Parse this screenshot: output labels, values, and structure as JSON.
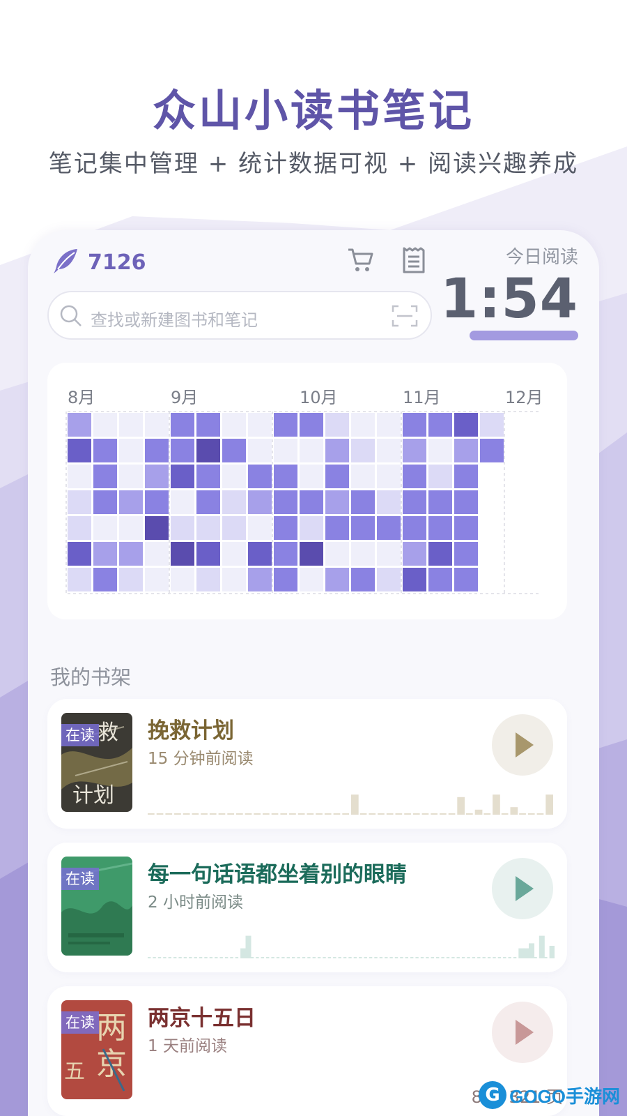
{
  "promo": {
    "title": "众山小读书笔记",
    "subtitle": "笔记集中管理 + 统计数据可视 + 阅读兴趣养成"
  },
  "header": {
    "coins": "7126",
    "icons": [
      "feather-icon",
      "cart-icon",
      "receipt-icon"
    ],
    "today_label": "今日阅读",
    "today_time": "1:54"
  },
  "search": {
    "placeholder": "查找或新建图书和笔记",
    "icons": [
      "search-icon",
      "scan-icon"
    ]
  },
  "heatmap": {
    "months": [
      "8月",
      "9月",
      "10月",
      "11月",
      "12月"
    ],
    "palette": [
      "#efeffa",
      "#dcdaf6",
      "#a7a0ea",
      "#8a82e2",
      "#6a5fc8",
      "#5a4cae"
    ],
    "columns": [
      [
        2,
        4,
        0,
        1,
        1,
        4,
        1
      ],
      [
        0,
        3,
        3,
        3,
        0,
        2,
        3
      ],
      [
        0,
        0,
        0,
        2,
        0,
        2,
        1
      ],
      [
        0,
        3,
        2,
        3,
        5,
        0,
        0
      ],
      [
        3,
        3,
        4,
        0,
        1,
        5,
        0
      ],
      [
        3,
        5,
        3,
        3,
        1,
        4,
        1
      ],
      [
        0,
        3,
        0,
        1,
        1,
        0,
        0
      ],
      [
        0,
        0,
        3,
        2,
        0,
        4,
        2
      ],
      [
        3,
        0,
        3,
        3,
        3,
        3,
        3
      ],
      [
        3,
        0,
        0,
        3,
        1,
        5,
        0
      ],
      [
        1,
        2,
        3,
        2,
        3,
        0,
        2
      ],
      [
        0,
        1,
        0,
        3,
        3,
        0,
        3
      ],
      [
        0,
        0,
        0,
        1,
        3,
        0,
        1
      ],
      [
        3,
        2,
        3,
        3,
        3,
        2,
        4
      ],
      [
        3,
        0,
        1,
        3,
        3,
        4,
        3
      ],
      [
        4,
        2,
        3,
        3,
        3,
        3,
        3
      ],
      [
        1,
        3
      ]
    ]
  },
  "shelf": {
    "title": "我的书架",
    "books": [
      {
        "title": "挽救计划",
        "time": "15 分钟前阅读",
        "status": "在读",
        "title_color": "#7a6533",
        "time_color": "#9a8a70",
        "button_bg": "#f1eee8",
        "accent": "#a8976c",
        "bar_color": "#e4dece",
        "bars": [
          0,
          0,
          0,
          0,
          0,
          0,
          0,
          0,
          0,
          0,
          0,
          0,
          0,
          0,
          0,
          0,
          0,
          0,
          0,
          0,
          0,
          0,
          0,
          8,
          0,
          0,
          0,
          0,
          0,
          0,
          0,
          0,
          0,
          0,
          0,
          7,
          0,
          2,
          0,
          8,
          0,
          3,
          0,
          0,
          0,
          8
        ]
      },
      {
        "title": "每一句话语都坐着别的眼睛",
        "time": "2 小时前阅读",
        "status": "在读",
        "title_color": "#1b6b5a",
        "time_color": "#7a8a86",
        "button_bg": "#e8f1ef",
        "accent": "#6aa89a",
        "bar_color": "#d4e7e2",
        "bars": [
          0,
          0,
          0,
          0,
          0,
          0,
          0,
          0,
          0,
          0,
          0,
          0,
          0,
          0,
          0,
          0,
          0,
          0,
          4,
          9,
          0,
          0,
          0,
          0,
          0,
          0,
          0,
          0,
          0,
          0,
          0,
          0,
          0,
          0,
          0,
          0,
          0,
          0,
          0,
          0,
          0,
          0,
          0,
          0,
          0,
          0,
          0,
          0,
          0,
          0,
          0,
          0,
          0,
          0,
          0,
          0,
          0,
          0,
          0,
          0,
          0,
          0,
          0,
          0,
          0,
          0,
          0,
          0,
          0,
          0,
          0,
          0,
          4,
          4,
          6,
          0,
          9,
          0,
          5
        ]
      },
      {
        "title": "两京十五日",
        "time": "1 天前阅读",
        "status": "在读",
        "title_color": "#7a3030",
        "time_color": "#9a8080",
        "button_bg": "#f5ecec",
        "accent": "#c89898",
        "bar_color": "#ecdada",
        "bars": [
          0,
          0,
          0,
          0,
          0,
          0,
          0,
          0,
          0,
          0,
          0,
          0,
          0,
          0,
          0,
          0,
          0,
          0,
          0,
          0,
          0,
          0,
          0,
          0,
          0,
          0,
          0,
          0,
          0,
          0,
          0,
          0,
          0,
          0,
          0,
          0,
          0,
          0,
          0,
          0,
          0,
          0,
          0,
          0,
          0,
          0,
          0,
          0,
          0,
          0,
          0,
          0,
          0,
          0,
          0,
          0,
          0,
          0,
          0,
          0,
          0,
          0,
          0,
          0,
          0,
          0,
          0,
          0,
          0,
          0,
          0,
          0,
          0,
          0,
          0,
          0,
          0,
          0,
          0,
          0
        ]
      }
    ]
  },
  "footer": {
    "page_hint": "89 / 321 页",
    "watermark": "GOGO手游网"
  }
}
